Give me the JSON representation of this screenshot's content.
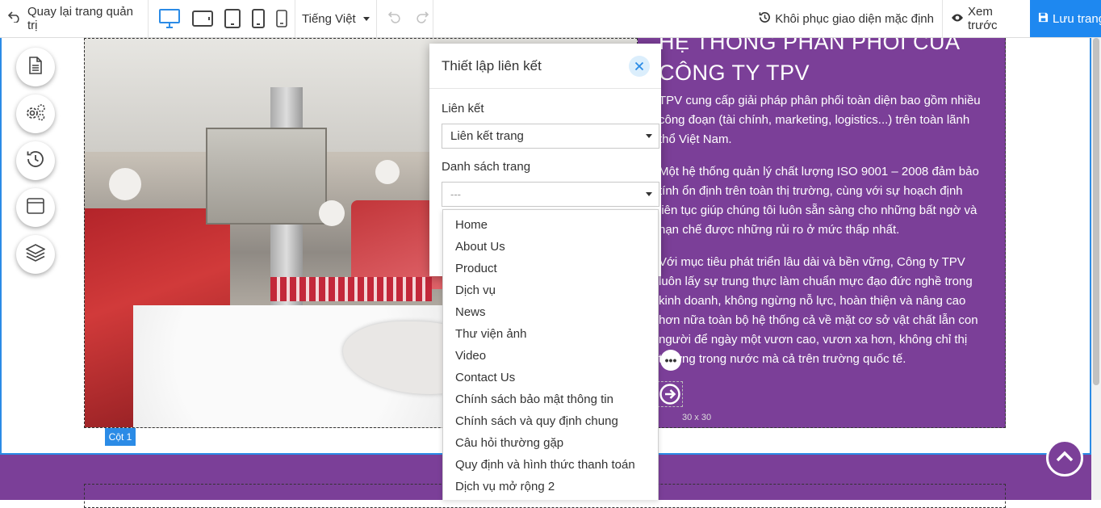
{
  "toolbar": {
    "back_label": "Quay lại trang quản trị",
    "devices": [
      "desktop-icon",
      "tablet-landscape-icon",
      "tablet-portrait-icon",
      "phone-large-icon",
      "phone-small-icon"
    ],
    "language": "Tiếng Việt",
    "restore_label": "Khôi phục giao diện mặc định",
    "preview_label": "Xem trước",
    "save_label": "Lưu trang"
  },
  "side_tools": [
    "page-icon",
    "settings-icon",
    "history-icon",
    "layout-icon",
    "layers-icon"
  ],
  "content": {
    "heading_line1": "HỆ THỐNG PHÂN PHỐI CỦA",
    "heading_line2": "CÔNG TY TPV",
    "para1": "TPV cung cấp giải pháp phân phối toàn diện bao gồm nhiều công đoạn (tài chính, marketing, logistics...) trên toàn lãnh thổ Việt Nam.",
    "para2": "Một hệ thống quản lý chất lượng ISO 9001 – 2008 đảm bảo tính ổn định trên toàn thị trường, cùng với sự hoạch định liên tục giúp chúng tôi luôn sẵn sàng cho những bất ngờ và hạn chế được những rủi ro ở mức thấp nhất.",
    "para3": "Với mục tiêu phát triển lâu dài và bền vững, Công ty TPV luôn lấy sự trung thực làm chuẩn mực đạo đức nghề trong kinh doanh, không ngừng nỗ lực, hoàn thiện và nâng cao hơn nữa toàn bộ hệ thống cả về mặt cơ sở vật chất lẫn con người để ngày một vươn cao, vươn xa hơn, không chỉ thị trường trong nước mà cả trên trường quốc tế.",
    "icon_size": "30 x 30",
    "column_tag": "Cột 1"
  },
  "link_panel": {
    "title": "Thiết lập liên kết",
    "link_label": "Liên kết",
    "link_value": "Liên kết trang",
    "pages_label": "Danh sách trang",
    "pages_placeholder": "---",
    "options": [
      "Home",
      "About Us",
      "Product",
      "Dịch vụ",
      "News",
      "Thư viện ảnh",
      "Video",
      "Contact Us",
      "Chính sách bảo mật thông tin",
      "Chính sách và quy định chung",
      "Câu hỏi thường gặp",
      "Quy định và hình thức thanh toán",
      "Dịch vụ mở rộng 2"
    ]
  },
  "colors": {
    "accent": "#2b8be6",
    "brand_purple": "#7b3f98",
    "save_button": "#1e88f0"
  }
}
